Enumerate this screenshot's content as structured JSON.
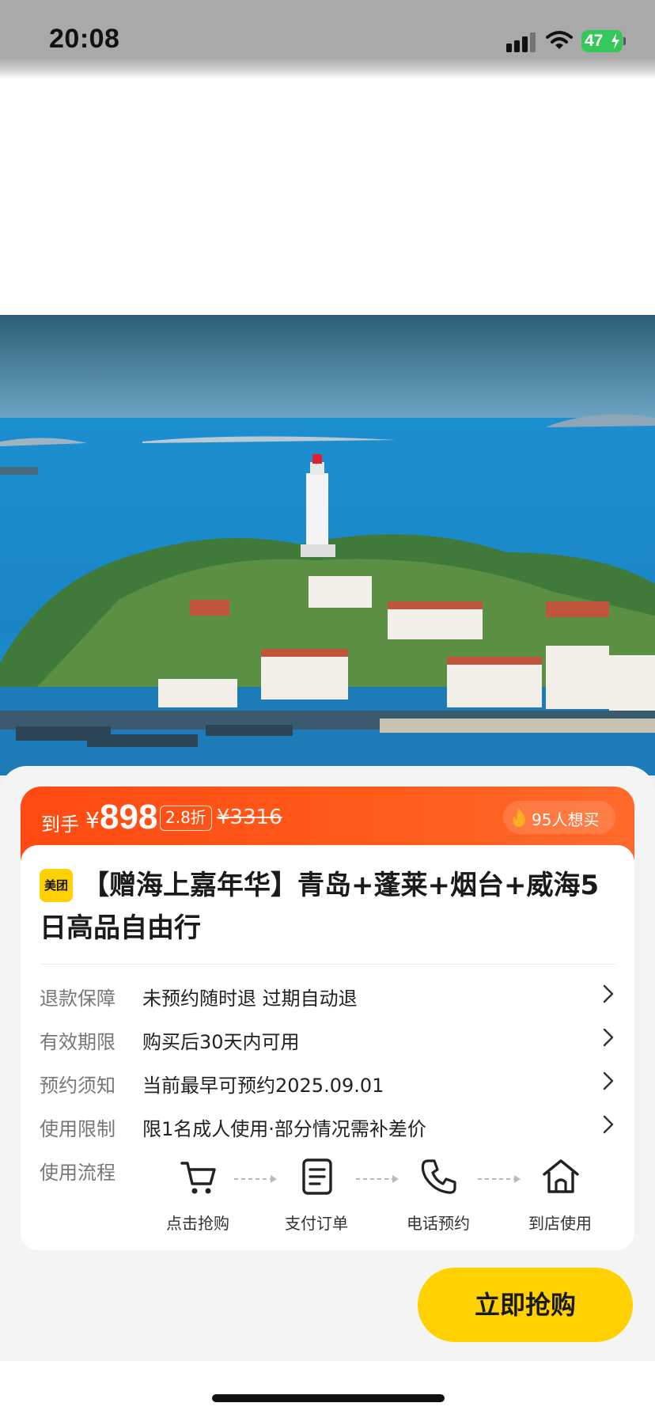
{
  "status_bar": {
    "time": "20:08",
    "battery": "47"
  },
  "price_bar": {
    "prefix": "到手",
    "currency": "¥",
    "price": "898",
    "discount": "2.8折",
    "original_price": "¥3316",
    "want_count": "95人想买"
  },
  "product": {
    "brand_badge": "美团",
    "title": "【赠海上嘉年华】青岛+蓬莱+烟台+威海5日高品自由行"
  },
  "info_rows": [
    {
      "label": "退款保障",
      "value": "未预约随时退 过期自动退"
    },
    {
      "label": "有效期限",
      "value": "购买后30天内可用"
    },
    {
      "label": "预约须知",
      "value": "当前最早可预约2025.09.01"
    },
    {
      "label": "使用限制",
      "value": "限1名成人使用·部分情况需补差价"
    }
  ],
  "usage_flow": {
    "label": "使用流程",
    "steps": [
      {
        "label": "点击抢购",
        "icon": "cart-icon"
      },
      {
        "label": "支付订单",
        "icon": "document-icon"
      },
      {
        "label": "电话预约",
        "icon": "phone-icon"
      },
      {
        "label": "到店使用",
        "icon": "home-icon"
      }
    ]
  },
  "buy_button": {
    "label": "立即抢购"
  },
  "colors": {
    "price_bar": "#ff4a12",
    "brand_yellow": "#ffd100",
    "battery_green": "#34c759"
  }
}
